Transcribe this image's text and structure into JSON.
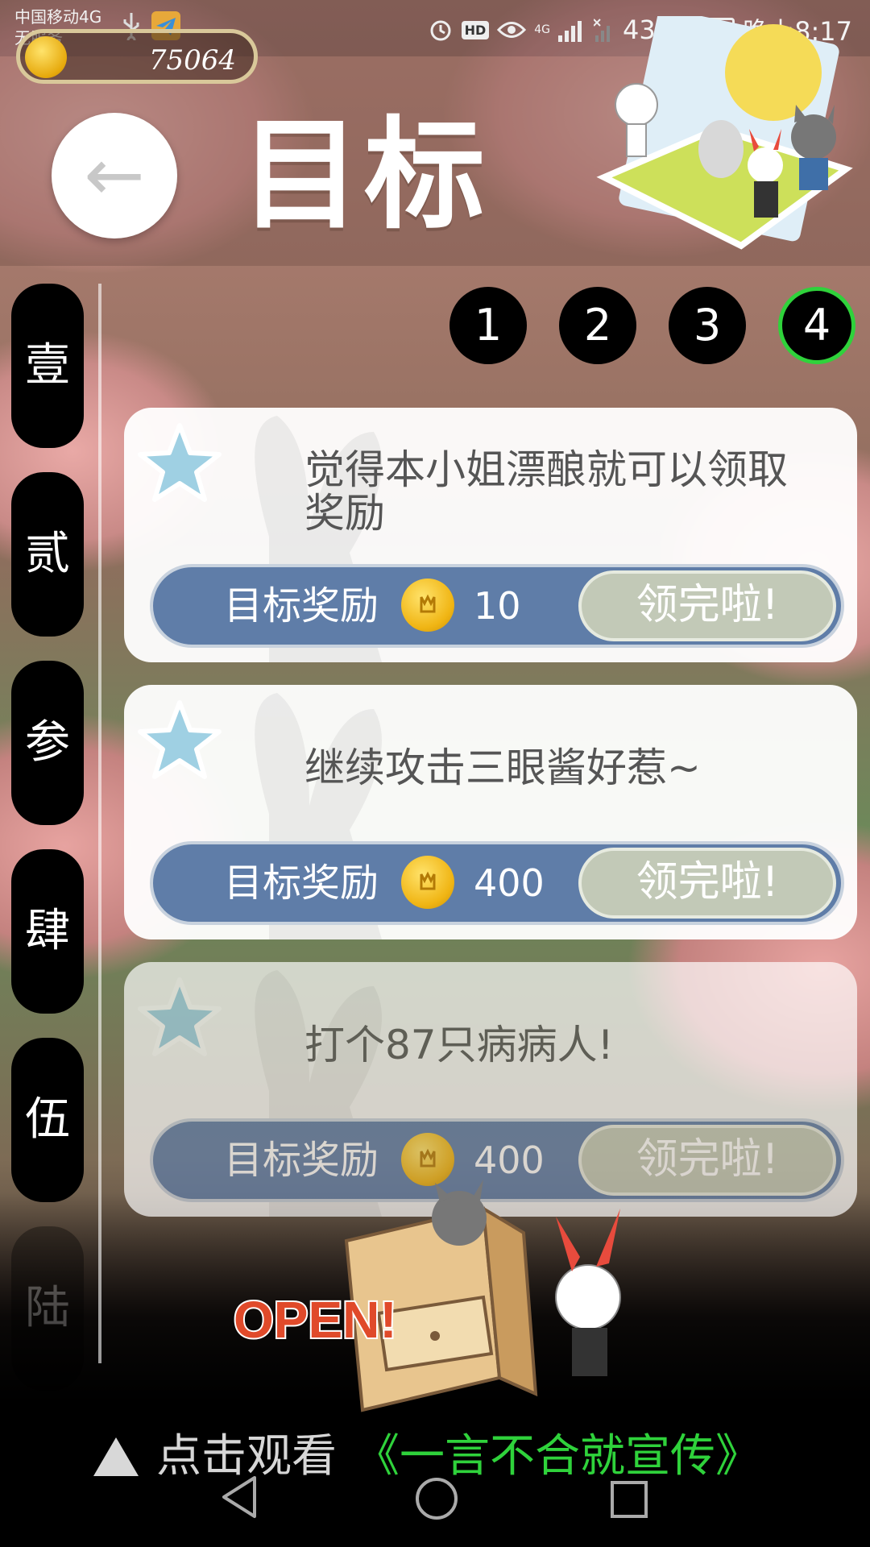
{
  "status_bar": {
    "carrier_line1": "中国移动4G",
    "carrier_line2": "无服务",
    "hd_badge": "HD",
    "network": "4G",
    "battery_percent_text": "43%",
    "battery_level": 0.43,
    "time": "晚上8:17"
  },
  "coins": {
    "value": "75064"
  },
  "header": {
    "back_glyph": "←",
    "title": "目标"
  },
  "page_tabs": [
    {
      "label": "1",
      "active": false
    },
    {
      "label": "2",
      "active": false
    },
    {
      "label": "3",
      "active": false
    },
    {
      "label": "4",
      "active": true
    }
  ],
  "chapters": [
    {
      "label": "壹"
    },
    {
      "label": "贰"
    },
    {
      "label": "参"
    },
    {
      "label": "肆"
    },
    {
      "label": "伍"
    },
    {
      "label": "陆"
    }
  ],
  "goals": [
    {
      "description": "觉得本小姐漂酿就可以领取奖励",
      "reward_label": "目标奖励",
      "reward_amount": "10",
      "claim_label": "领完啦!"
    },
    {
      "description": "继续攻击三眼酱好惹~",
      "reward_label": "目标奖励",
      "reward_amount": "400",
      "claim_label": "领完啦!"
    },
    {
      "description": "打个87只病病人!",
      "reward_label": "目标奖励",
      "reward_amount": "400",
      "claim_label": "领完啦!"
    }
  ],
  "ad": {
    "art_text": "OPEN!",
    "prefix": "点击观看",
    "link": "《一言不合就宣传》"
  },
  "colors": {
    "reward_bar": "#5f7da8",
    "claim_button": "#c2c9b7",
    "active_tab_ring": "#2fd23b",
    "ad_link": "#2fd23b"
  }
}
